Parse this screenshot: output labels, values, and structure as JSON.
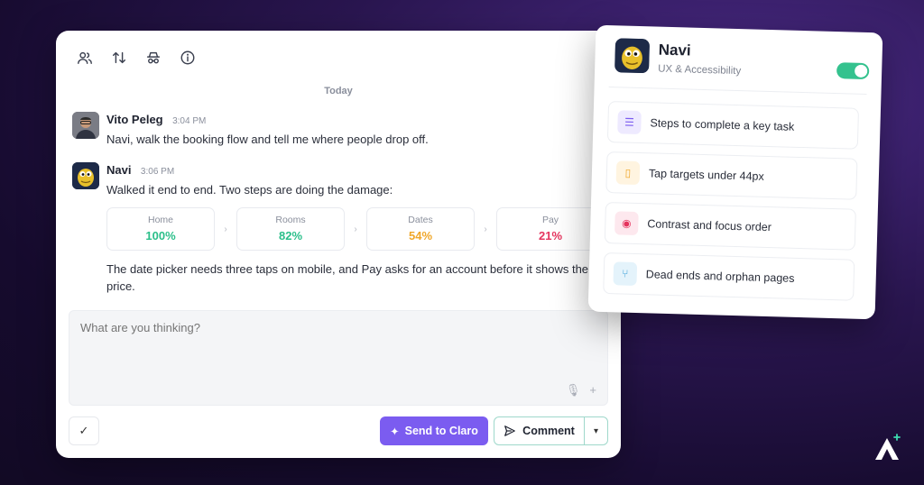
{
  "toolbar": {
    "icons": [
      "people-icon",
      "sort-icon",
      "incognito-icon",
      "info-icon"
    ]
  },
  "chat": {
    "day_separator": "Today",
    "messages": [
      {
        "author": "Vito Peleg",
        "time": "3:04 PM",
        "text": "Navi, walk the booking flow and tell me where people drop off."
      },
      {
        "author": "Navi",
        "time": "3:06 PM",
        "text": "Walked it end to end. Two steps are doing the damage:"
      }
    ],
    "funnel": [
      {
        "label": "Home",
        "value": "100%",
        "color": "#2bbf8a"
      },
      {
        "label": "Rooms",
        "value": "82%",
        "color": "#2bbf8a"
      },
      {
        "label": "Dates",
        "value": "54%",
        "color": "#f0a72a"
      },
      {
        "label": "Pay",
        "value": "21%",
        "color": "#e5345e"
      }
    ],
    "followup": "The date picker needs three taps on mobile, and Pay asks for an account before it shows the price."
  },
  "composer": {
    "placeholder": "What are you thinking?",
    "send_label": "Send to Claro",
    "comment_label": "Comment"
  },
  "agent_card": {
    "name": "Navi",
    "subtitle": "UX & Accessibility",
    "enabled": true,
    "skills": [
      {
        "label": "Steps to complete a key task",
        "icon": "checklist-icon",
        "bg": "#eeeaff",
        "fg": "#7b5cf0"
      },
      {
        "label": "Tap targets under 44px",
        "icon": "phone-icon",
        "bg": "#fff4e0",
        "fg": "#f0a72a"
      },
      {
        "label": "Contrast and focus order",
        "icon": "eye-icon",
        "bg": "#fde8ee",
        "fg": "#e5345e"
      },
      {
        "label": "Dead ends and orphan pages",
        "icon": "branch-icon",
        "bg": "#e4f3fb",
        "fg": "#3aa0d8"
      }
    ]
  },
  "colors": {
    "accent": "#7b5cf0",
    "toggle_on": "#34c28e"
  }
}
